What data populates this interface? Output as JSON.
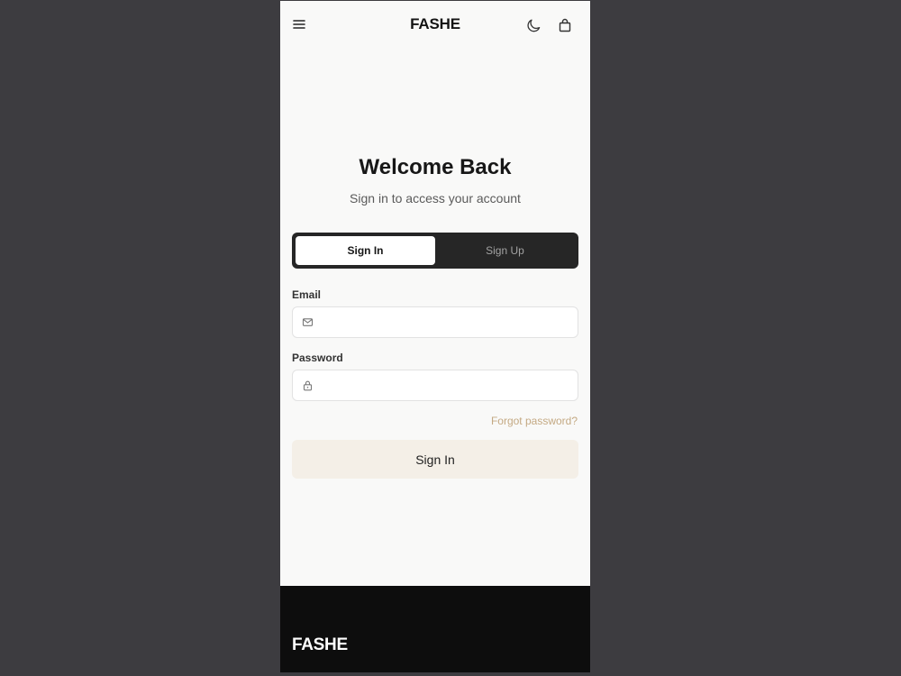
{
  "header": {
    "brand": "FASHE",
    "icons": {
      "menu": "menu-icon",
      "theme": "moon-icon",
      "bag": "shopping-bag-icon"
    }
  },
  "auth": {
    "title": "Welcome Back",
    "subtitle": "Sign in to access your account",
    "tabs": [
      {
        "label": "Sign In",
        "active": true
      },
      {
        "label": "Sign Up",
        "active": false
      }
    ],
    "email": {
      "label": "Email",
      "value": "",
      "placeholder": "",
      "icon": "mail-icon"
    },
    "password": {
      "label": "Password",
      "value": "",
      "placeholder": "",
      "icon": "lock-icon"
    },
    "forgot_label": "Forgot password?",
    "submit_label": "Sign In"
  },
  "footer": {
    "brand": "FASHE"
  },
  "colors": {
    "background": "#3d3c40",
    "surface": "#f9f9f8",
    "tabs_bg": "#262626",
    "accent_link": "#c4a983",
    "button_bg": "#f4efe7",
    "footer_bg": "#0d0d0d"
  }
}
